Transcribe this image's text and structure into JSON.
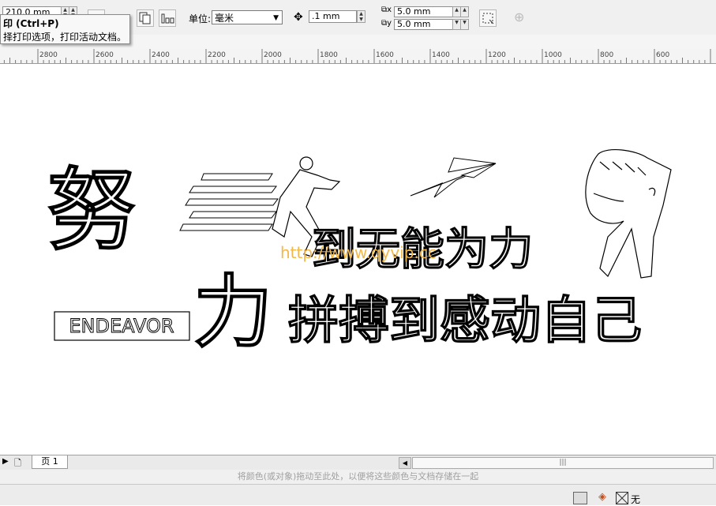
{
  "toolbar": {
    "page_width": "210.0 mm",
    "unit_label": "单位:",
    "unit_value": "毫米",
    "nudge_value": ".1 mm",
    "dup_x": "5.0 mm",
    "dup_y": "5.0 mm"
  },
  "tooltip": {
    "title": "印 (Ctrl+P)",
    "description": "择打印选项，打印活动文档。"
  },
  "ruler": {
    "labels": [
      "2800",
      "2600",
      "2400",
      "2200",
      "2000",
      "1800",
      "1600",
      "1400",
      "1200",
      "1000",
      "800",
      "600"
    ]
  },
  "artwork": {
    "big_char_1": "努",
    "big_char_2": "力",
    "line1": "到无能为力",
    "line2": "拼搏到感动自己",
    "english": "ENDEAVOR",
    "watermark": "http://www.qyvip.cc"
  },
  "status": {
    "page_tab": "页 1",
    "scroll_grip": "|||"
  },
  "palette_hint": "将颜色(或对象)拖动至此处，以便将这些颜色与文档存储在一起",
  "bottom": {
    "fill_none": "无"
  }
}
